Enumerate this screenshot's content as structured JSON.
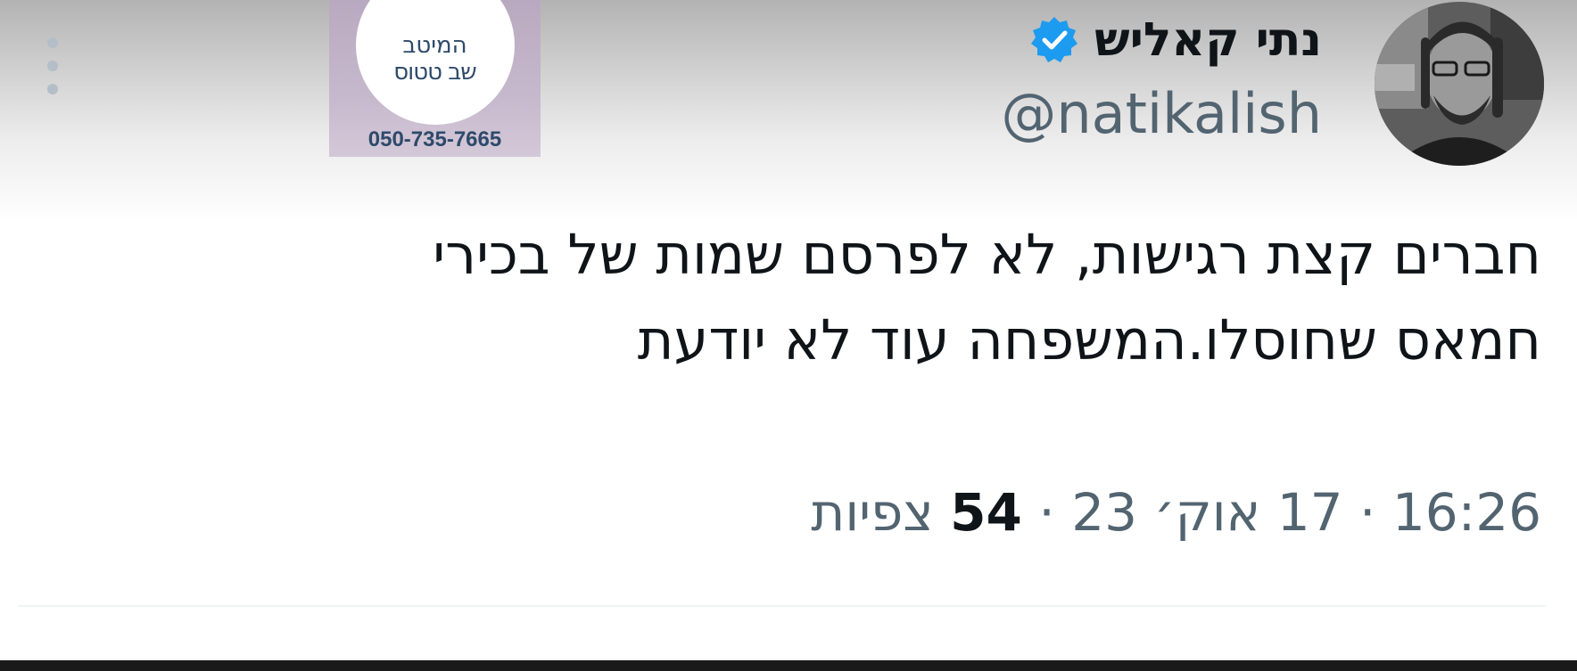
{
  "author": {
    "display_name": "נתי קאליש",
    "handle": "@natikalish",
    "verified": true,
    "badge_color": "#1d9bf0"
  },
  "logo_stamp": {
    "line1": "המיטב",
    "line2": "שב טטוס",
    "phone": "050-735-7665"
  },
  "tweet": {
    "lines": [
      "חברים קצת רגישות, לא לפרסם שמות של בכירי",
      "חמאס שחוסלו.המשפחה עוד לא יודעת"
    ]
  },
  "meta": {
    "time": "16:26",
    "separator": " · ",
    "date": "17 אוק׳ 23",
    "views_count": "54",
    "views_label": "צפיות"
  },
  "colors": {
    "text": "#0f1419",
    "secondary": "#536471",
    "divider": "#eff3f4"
  },
  "icons": {
    "verified": "verified-badge-icon",
    "more": "more-options-icon"
  }
}
